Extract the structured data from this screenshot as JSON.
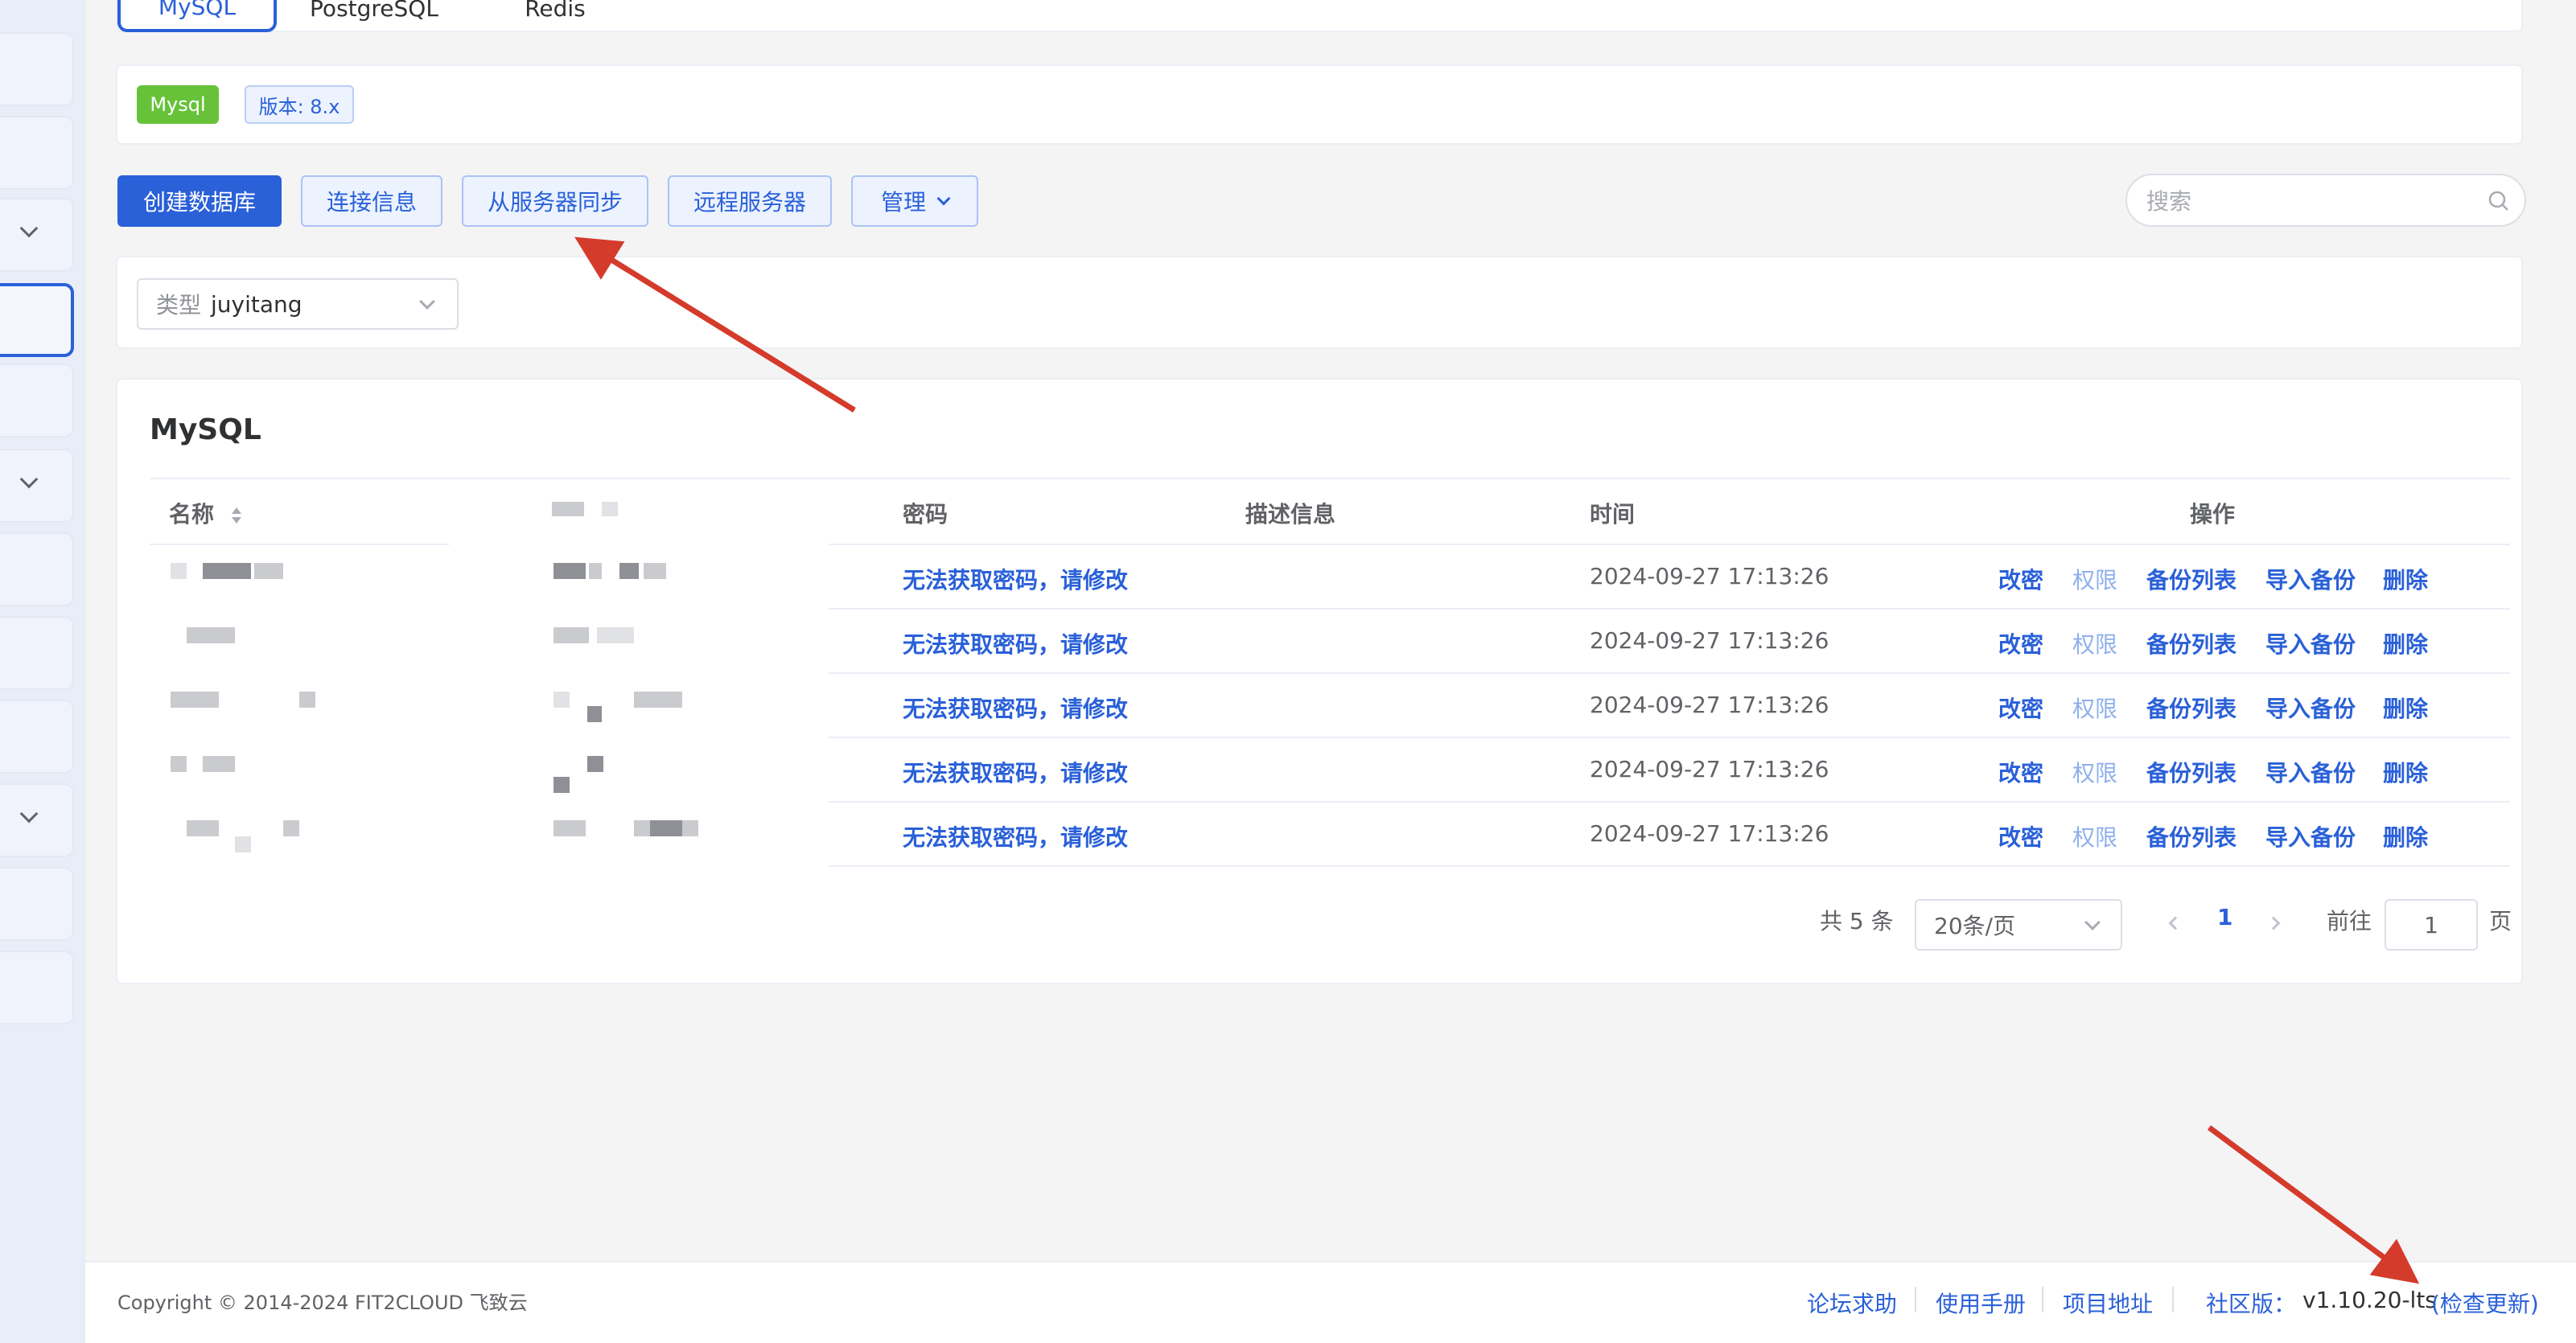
{
  "tabs": [
    {
      "label": "MySQL",
      "active": true
    },
    {
      "label": "PostgreSQL",
      "active": false
    },
    {
      "label": "Redis",
      "active": false
    }
  ],
  "badges": {
    "type": "Mysql",
    "version": "版本: 8.x"
  },
  "toolbar": {
    "create": "创建数据库",
    "connect_info": "连接信息",
    "sync": "从服务器同步",
    "remote": "远程服务器",
    "manage": "管理"
  },
  "search": {
    "placeholder": "搜索"
  },
  "filter": {
    "label": "类型",
    "value": "juyitang"
  },
  "table": {
    "title": "MySQL",
    "headers": {
      "name": "名称",
      "password": "密码",
      "description": "描述信息",
      "time": "时间",
      "actions": "操作"
    },
    "rows": [
      {
        "password": "无法获取密码，请修改",
        "time": "2024-09-27 17:13:26"
      },
      {
        "password": "无法获取密码，请修改",
        "time": "2024-09-27 17:13:26"
      },
      {
        "password": "无法获取密码，请修改",
        "time": "2024-09-27 17:13:26"
      },
      {
        "password": "无法获取密码，请修改",
        "time": "2024-09-27 17:13:26"
      },
      {
        "password": "无法获取密码，请修改",
        "time": "2024-09-27 17:13:26"
      }
    ],
    "actions": [
      "改密",
      "权限",
      "备份列表",
      "导入备份",
      "删除"
    ]
  },
  "pagination": {
    "total": "共 5 条",
    "page_size": "20条/页",
    "current": "1",
    "goto_label": "前往",
    "goto_value": "1",
    "page_suffix": "页"
  },
  "footer": {
    "copyright": "Copyright © 2014-2024 FIT2CLOUD 飞致云",
    "links": [
      "论坛求助",
      "使用手册",
      "项目地址"
    ],
    "edition_label": "社区版：",
    "version": "v1.10.20-lts",
    "check_update": "(检查更新)"
  },
  "colors": {
    "accent": "#2a60d8",
    "badge_green": "#67c23a",
    "annotation_arrow": "#d43b2b"
  },
  "icons": [
    "search-icon",
    "chevron-down-icon",
    "sort-icon",
    "chevron-left-icon",
    "chevron-right-icon"
  ]
}
